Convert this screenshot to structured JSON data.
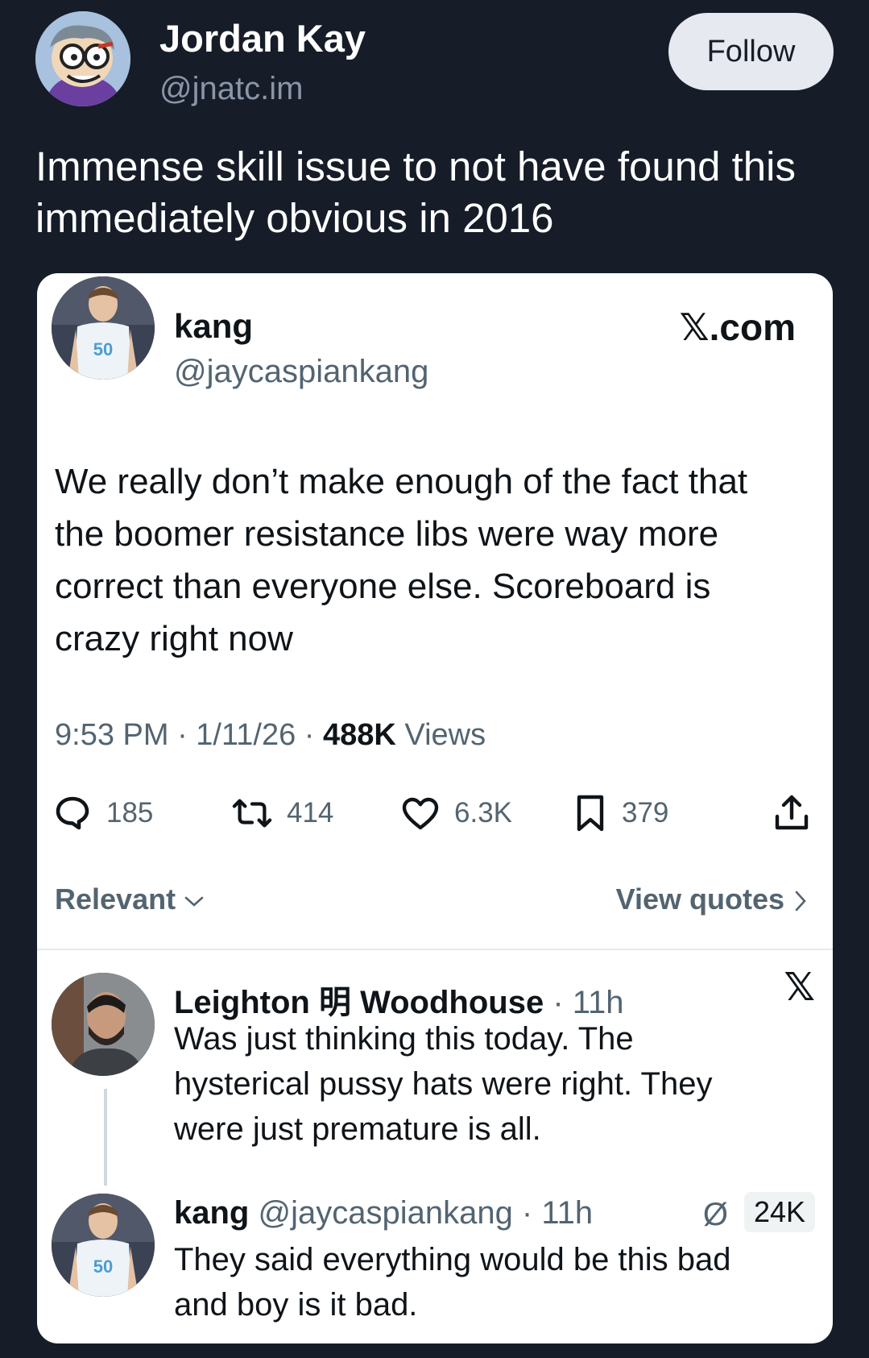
{
  "author": {
    "name": "Jordan Kay",
    "handle": "@jnatc.im",
    "follow_label": "Follow"
  },
  "post": {
    "text": "Immense skill issue to not have found this immediately obvious in 2016"
  },
  "quoted": {
    "name": "kang",
    "handle": "@jaycaspiankang",
    "source": "𝕏.com",
    "body": "We really don’t make enough of the fact that the boomer resistance libs were way more correct than everyone else. Scoreboard is crazy right now",
    "time": "9:53 PM · 1/11/26 · ",
    "views_count": "488K",
    "views_label": " Views",
    "stats": {
      "replies": "185",
      "reposts": "414",
      "likes": "6.3K",
      "bookmarks": "379"
    },
    "sort_label": "Relevant",
    "view_quotes_label": "View quotes",
    "replies": [
      {
        "name": "Leighton 明 Woodhouse",
        "meta": " · 11h",
        "text": "Was just thinking this today. The hysterical pussy hats were right. They were just premature is all.",
        "source_icon": "𝕏"
      },
      {
        "name": "kang",
        "meta": " @jaycaspiankang · 11h",
        "text": "They said everything would be this bad and boy is it bad.",
        "count": "24K"
      }
    ]
  },
  "colors": {
    "background": "#161d29",
    "card": "#ffffff",
    "muted_text": "#536471",
    "follow_bg": "#e6e9ef"
  }
}
